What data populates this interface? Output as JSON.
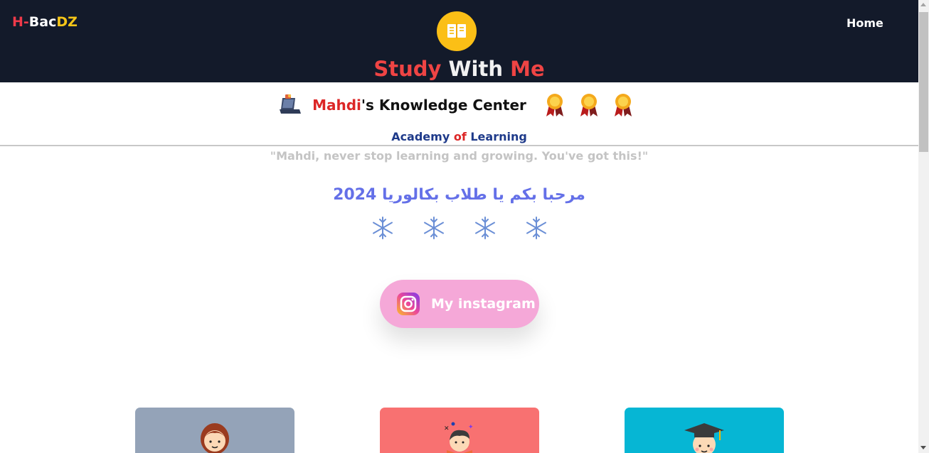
{
  "header": {
    "brand": {
      "part1": "H-",
      "part2": "Bac",
      "part3": "DZ"
    },
    "nav": {
      "home_label": "Home"
    },
    "logo_icon": "open-book-icon",
    "title": {
      "word1": "Study",
      "word2": "With",
      "word3": "Me"
    }
  },
  "knowledge_center": {
    "name": "Mahdi",
    "suffix": "'s Knowledge Center",
    "icons": [
      "laptop-icon",
      "medal-icon",
      "medal-icon",
      "medal-icon"
    ]
  },
  "academy": {
    "part1": "Academy ",
    "part2": "of",
    "part3": " Learning"
  },
  "quote": "\"Mahdi, never stop learning and growing. You've got this!\"",
  "welcome": "مرحبا بكم يا طلاب بكالوريا 2024",
  "snowflakes": [
    "snowflake-icon",
    "snowflake-icon",
    "snowflake-icon",
    "snowflake-icon"
  ],
  "instagram_button": {
    "label": "My instagram",
    "icon": "instagram-icon"
  },
  "cards": [
    {
      "icon": "female-student-icon",
      "color": "#94a3b8"
    },
    {
      "icon": "reading-student-icon",
      "color": "#f87171"
    },
    {
      "icon": "graduate-icon",
      "color": "#06b6d4"
    }
  ],
  "colors": {
    "header_bg": "#131a2a",
    "accent_red": "#ef4444",
    "accent_yellow": "#fbbf16",
    "academy_blue": "#1e3a8a",
    "welcome_blue": "#6470e8",
    "instagram_pink": "#f5a8d8"
  }
}
